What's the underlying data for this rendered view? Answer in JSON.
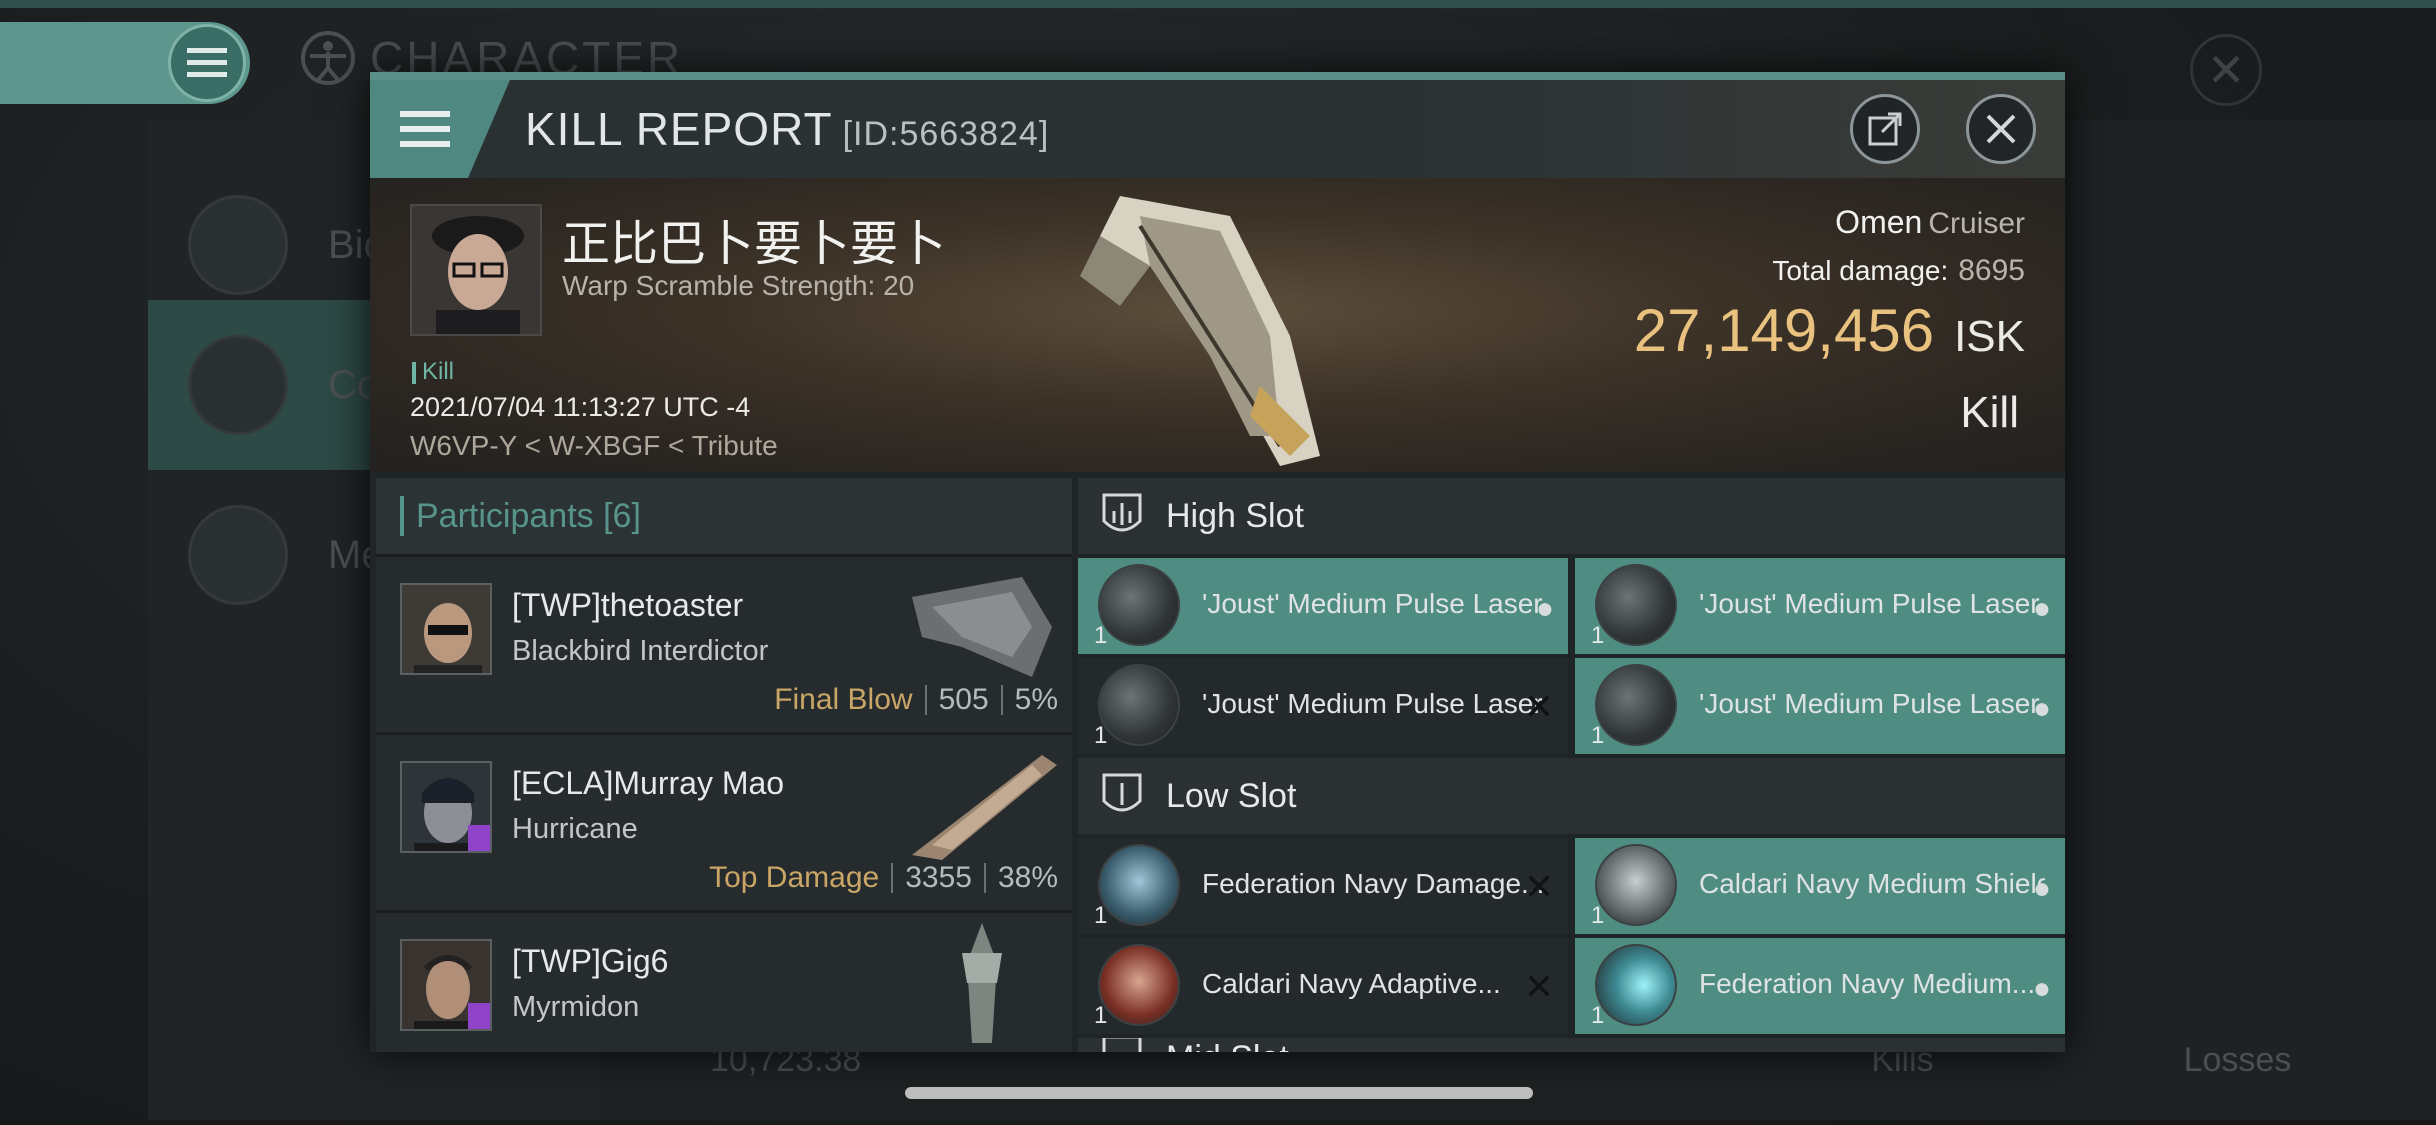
{
  "background": {
    "title": "CHARACTER",
    "sidebar_items": [
      {
        "label": "Bio"
      },
      {
        "label": "Co"
      },
      {
        "label": "Me"
      }
    ],
    "stats": {
      "value": "10,723.38",
      "kills_label": "Kills",
      "losses_label": "Losses"
    }
  },
  "modal": {
    "title": "KILL REPORT",
    "id_label": "[ID:5663824]",
    "victim": {
      "name": "正比巴卜要卜要卜",
      "subtitle": "Warp Scramble Strength: 20",
      "tag": "Kill",
      "time": "2021/07/04 11:13:27 UTC -4",
      "location": "W6VP-Y < W-XBGF < Tribute"
    },
    "ship": {
      "type": "Omen",
      "class": "Cruiser",
      "total_damage_label": "Total damage:",
      "total_damage": "8695",
      "isk_value": "27,149,456",
      "isk_unit": "ISK",
      "result": "Kill"
    },
    "participants": {
      "label": "Participants",
      "count": "[6]",
      "rows": [
        {
          "name": "[TWP]thetoaster",
          "ship": "Blackbird Interdictor",
          "stat_label": "Final Blow",
          "damage": "505",
          "percent": "5%"
        },
        {
          "name": "[ECLA]Murray Mao",
          "ship": "Hurricane",
          "stat_label": "Top Damage",
          "damage": "3355",
          "percent": "38%"
        },
        {
          "name": "[TWP]Gig6",
          "ship": "Myrmidon",
          "stat_label": "",
          "damage": "",
          "percent": ""
        }
      ]
    },
    "slots": {
      "high": {
        "label": "High Slot",
        "items": [
          {
            "name": "'Joust' Medium Pulse Laser",
            "qty": "1",
            "state": "dropped"
          },
          {
            "name": "'Joust' Medium Pulse Laser",
            "qty": "1",
            "state": "dropped"
          },
          {
            "name": "'Joust' Medium Pulse Laser",
            "qty": "1",
            "state": "destroyed"
          },
          {
            "name": "'Joust' Medium Pulse Laser",
            "qty": "1",
            "state": "dropped"
          }
        ]
      },
      "low": {
        "label": "Low Slot",
        "items": [
          {
            "name": "Federation Navy Damage...",
            "qty": "1",
            "state": "destroyed"
          },
          {
            "name": "Caldari Navy Medium Shield ...",
            "qty": "1",
            "state": "dropped"
          },
          {
            "name": "Caldari Navy Adaptive...",
            "qty": "1",
            "state": "destroyed"
          },
          {
            "name": "Federation Navy Medium...",
            "qty": "1",
            "state": "dropped"
          }
        ]
      },
      "mid_label_partial": "Mid Slot"
    }
  },
  "colors": {
    "accent_teal": "#5a8f87",
    "isk_gold": "#e9c27f",
    "dropped_slot": "#4f8d82",
    "destroyed_slot": "#242a2c",
    "badge_purple": "#8e43c9"
  }
}
